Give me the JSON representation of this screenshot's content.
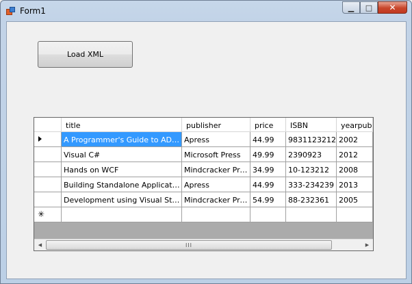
{
  "window": {
    "title": "Form1",
    "minimize_glyph": "▁",
    "maximize_glyph": "□",
    "close_glyph": "✕"
  },
  "load_button": {
    "label": "Load XML"
  },
  "grid": {
    "columns": [
      "title",
      "publisher",
      "price",
      "ISBN",
      "yearpublis"
    ],
    "rows": [
      [
        "A Programmer's Guide to ADO.N...",
        "Apress",
        "44.99",
        "9831123212",
        "2002"
      ],
      [
        "Visual C#",
        "Microsoft Press",
        "49.99",
        "2390923",
        "2012"
      ],
      [
        "Hands on WCF",
        "Mindcracker Press",
        "34.99",
        "10-123212",
        "2008"
      ],
      [
        "Building Standalone Applications",
        "Apress",
        "44.99",
        "333-234239",
        "2013"
      ],
      [
        "Development using Visual Studio ...",
        "Mindcracker Press",
        "54.99",
        "88-232361",
        "2005"
      ]
    ],
    "new_row_glyph": "✳",
    "scroll_left_glyph": "◀",
    "scroll_right_glyph": "▶",
    "scroll_thumb_grip": "III"
  }
}
